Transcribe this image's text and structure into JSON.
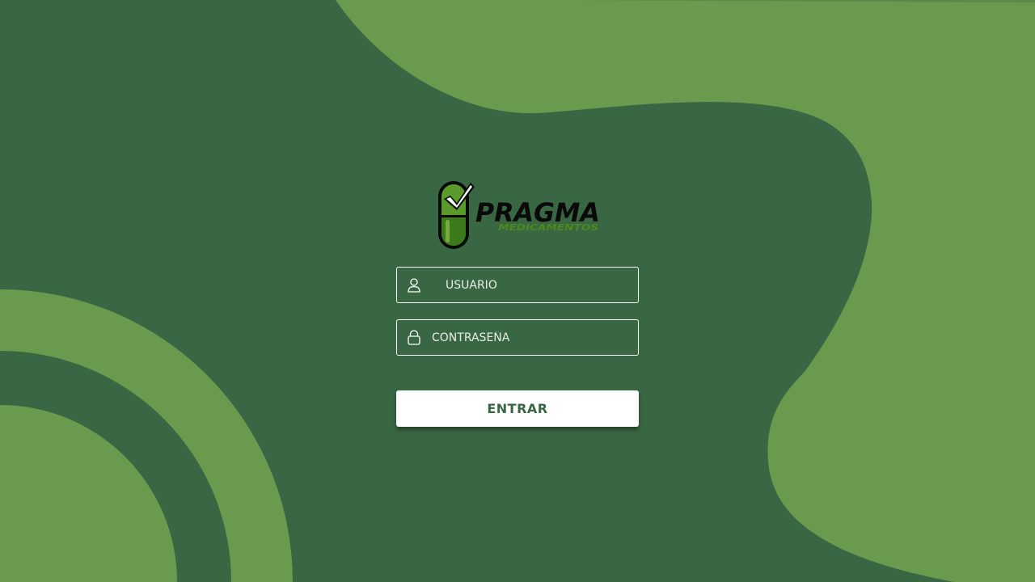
{
  "colors": {
    "background": "#396743",
    "accent_shape": "#6a9a4e",
    "button_bg": "#ffffff",
    "button_text": "#396743",
    "field_border": "#ffffff"
  },
  "logo": {
    "brand": "PRAGMA",
    "tagline": "MEDICAMENTOS",
    "icon": "pill-check-icon"
  },
  "form": {
    "username": {
      "placeholder": "USUARIO",
      "value": "",
      "icon": "user-icon"
    },
    "password": {
      "placeholder": "CONTRASEÑA",
      "value": "",
      "icon": "lock-icon"
    },
    "submit_label": "ENTRAR"
  }
}
